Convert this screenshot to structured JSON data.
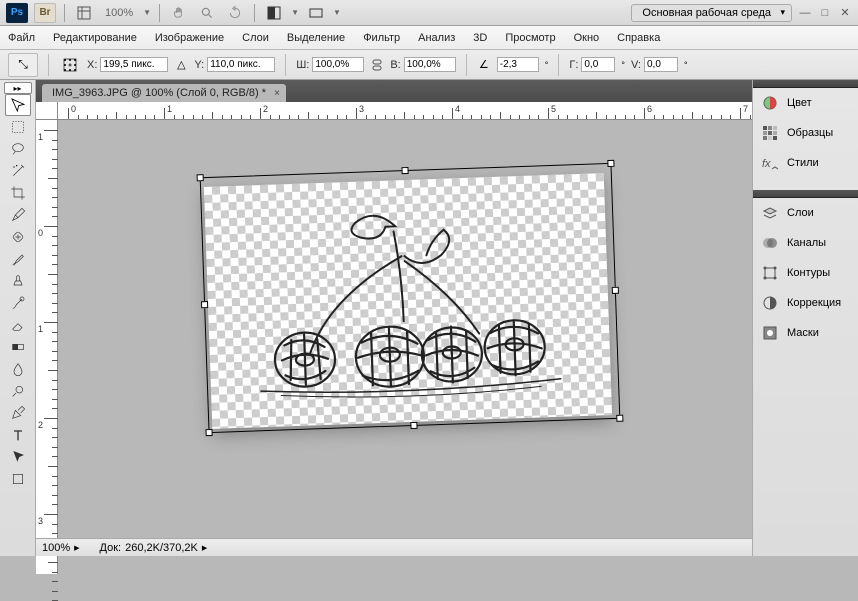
{
  "titlebar": {
    "ps_badge": "Ps",
    "br_badge": "Br",
    "zoom": "100%",
    "workspace_label": "Основная рабочая среда"
  },
  "menu": {
    "file": "Файл",
    "edit": "Редактирование",
    "image": "Изображение",
    "layer": "Слои",
    "select": "Выделение",
    "filter": "Фильтр",
    "analysis": "Анализ",
    "threeD": "3D",
    "view": "Просмотр",
    "window": "Окно",
    "help": "Справка"
  },
  "options": {
    "x_label": "X:",
    "x_value": "199,5 пикс.",
    "y_label": "Y:",
    "y_value": "110,0 пикс.",
    "w_label": "Ш:",
    "w_value": "100,0%",
    "h_label": "В:",
    "h_value": "100,0%",
    "angle_label": "",
    "angle_value": "-2,3",
    "gh_label": "Г:",
    "gh_value": "0,0",
    "v_label": "V:",
    "v_value": "0,0"
  },
  "tab": {
    "title": "IMG_3963.JPG @ 100% (Слой 0, RGB/8) *"
  },
  "ruler_h": [
    "0",
    "1",
    "2",
    "3",
    "4",
    "5",
    "6",
    "7"
  ],
  "ruler_v": [
    "1",
    "0",
    "1",
    "2",
    "3"
  ],
  "status": {
    "zoom": "100%",
    "doc_label": "Док:",
    "doc_value": "260,2K/370,2K"
  },
  "panels": {
    "color": "Цвет",
    "swatches": "Образцы",
    "styles": "Стили",
    "layers": "Слои",
    "channels": "Каналы",
    "paths": "Контуры",
    "adjustments": "Коррекция",
    "masks": "Маски"
  }
}
